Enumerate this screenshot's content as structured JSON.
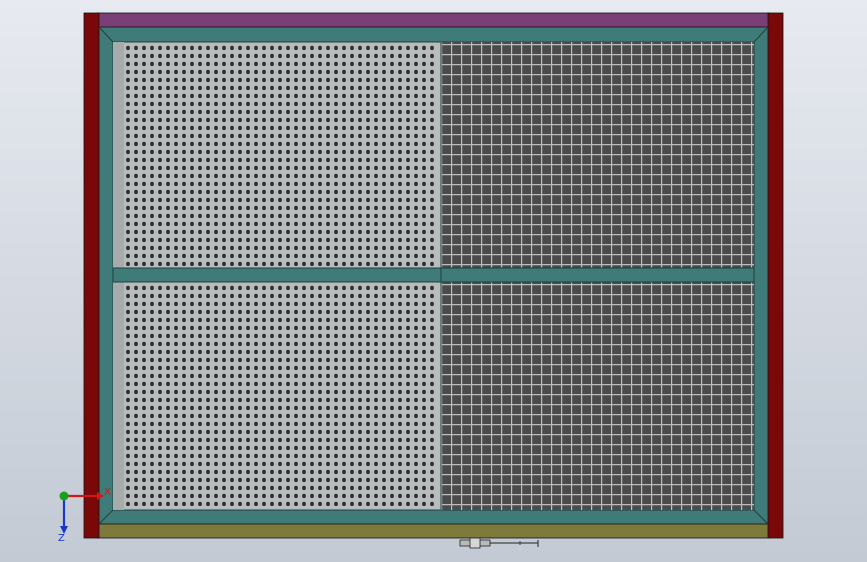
{
  "viewport": {
    "background_top": "#e7eaf0",
    "background_bottom": "#c3cad4"
  },
  "model": {
    "colors": {
      "side_rail": "#7a0808",
      "top_rail": "#7b3f78",
      "bottom_rail": "#7d7a3c",
      "frame": "#3f7b78",
      "frame_edge": "#1f3f3e",
      "perforated_panel": "#b8bcbc",
      "perforation_hole": "#2e2e2e",
      "mesh_background": "#4b4b4b",
      "mesh_wire": "#bdbdbd"
    },
    "panels": {
      "left": "perforated-sheet",
      "right": "wire-mesh",
      "rows": 2
    },
    "latch": "latch-bolt-icon"
  },
  "triad": {
    "x_label": "X",
    "y_label": "Y",
    "z_label": "Z",
    "x_color": "#d01818",
    "y_color": "#18a018",
    "z_color": "#1838c8"
  }
}
